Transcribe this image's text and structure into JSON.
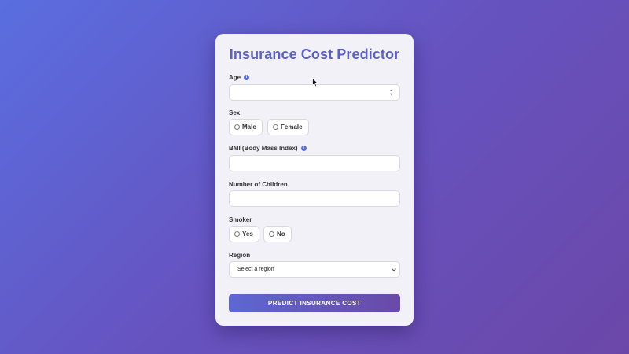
{
  "form": {
    "title": "Insurance Cost Predictor",
    "age": {
      "label": "Age",
      "value": ""
    },
    "sex": {
      "label": "Sex",
      "options": [
        "Male",
        "Female"
      ]
    },
    "bmi": {
      "label": "BMI (Body Mass Index)",
      "value": ""
    },
    "children": {
      "label": "Number of Children",
      "value": ""
    },
    "smoker": {
      "label": "Smoker",
      "options": [
        "Yes",
        "No"
      ]
    },
    "region": {
      "label": "Region",
      "selected": "Select a region"
    },
    "submit_label": "PREDICT INSURANCE COST",
    "info_icon_glyph": "i"
  },
  "colors": {
    "accent": "#5a5fc9",
    "button_start": "#5d67d3",
    "button_end": "#6a4aa6",
    "background_start": "#5a6ee0",
    "background_end": "#6b47a8"
  },
  "icons": [
    "info-icon",
    "spinner-icon",
    "chevron-down-icon",
    "cursor-icon"
  ]
}
